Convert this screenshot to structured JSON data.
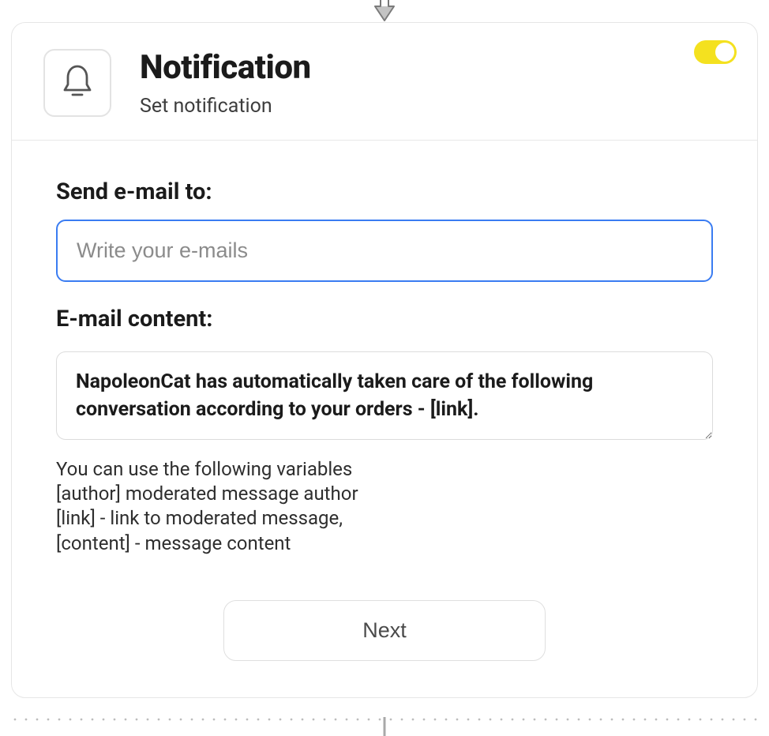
{
  "connector": {
    "icon_name": "arrow-down-icon"
  },
  "card": {
    "header": {
      "icon_name": "bell-icon",
      "title": "Notification",
      "subtitle": "Set notification"
    },
    "toggle": {
      "enabled": true
    },
    "body": {
      "email_to": {
        "label": "Send e-mail to:",
        "placeholder": "Write your e-mails",
        "value": ""
      },
      "email_content": {
        "label": "E-mail content:",
        "value": "NapoleonCat has automatically taken care of the following conversation according to your orders - [link]."
      },
      "help_text": "You can use the following variables\n[author] moderated message author\n[link] - link to moderated message,\n[content] - message content",
      "next_button": "Next"
    }
  }
}
